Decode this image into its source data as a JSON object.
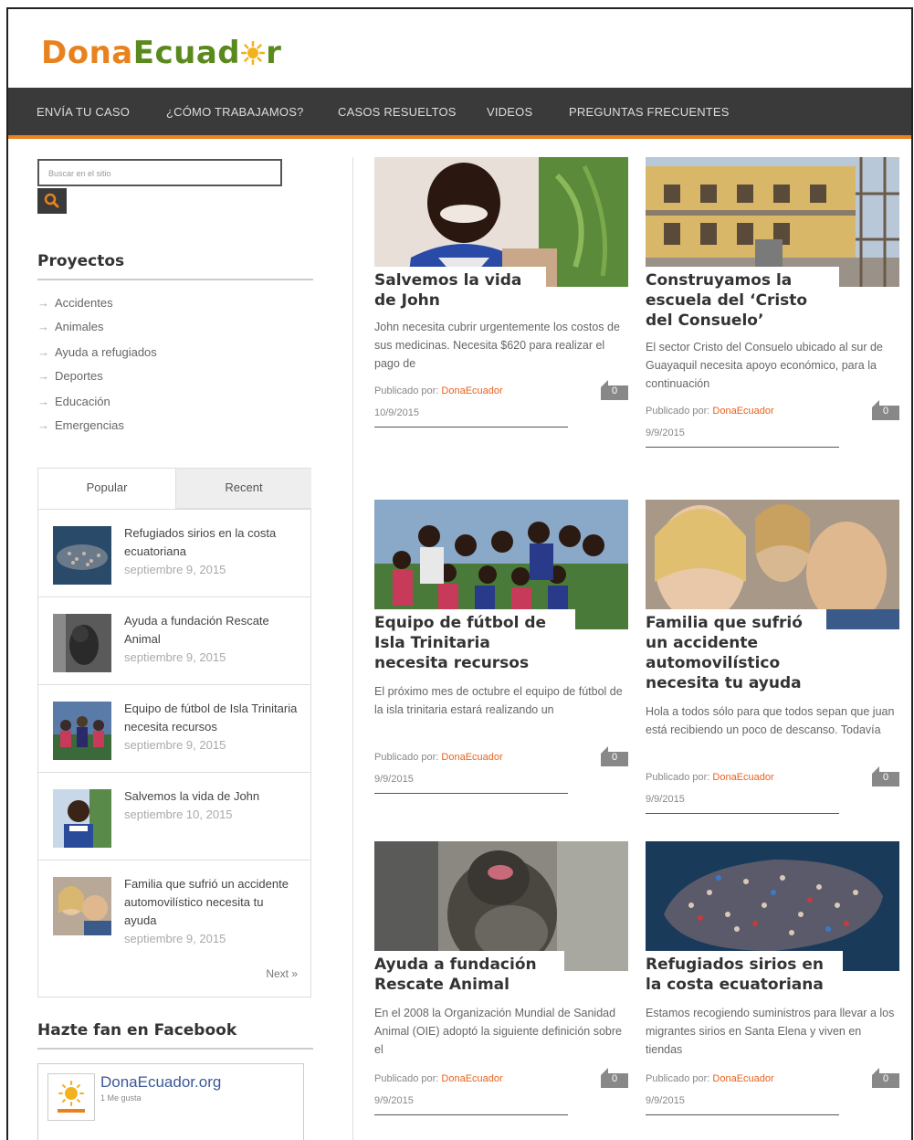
{
  "brand": {
    "part1": "Dona",
    "part2": "Ecuad",
    "part3": "r",
    "colors": {
      "orange": "#e8821e",
      "green": "#5a8a1e"
    }
  },
  "nav": [
    "ENVÍA TU CASO",
    "¿CÓMO TRABAJAMOS?",
    "CASOS RESUELTOS",
    "VIDEOS",
    "PREGUNTAS FRECUENTES"
  ],
  "search": {
    "placeholder": "Buscar en el sitio"
  },
  "projects": {
    "heading": "Proyectos",
    "items": [
      "Accidentes",
      "Animales",
      "Ayuda a refugiados",
      "Deportes",
      "Educación",
      "Emergencias"
    ]
  },
  "tabs": {
    "popular": "Popular",
    "recent": "Recent",
    "next": "Next »"
  },
  "popular": [
    {
      "title": "Refugiados sirios en la costa ecuatoriana",
      "date": "septiembre 9, 2015"
    },
    {
      "title": "Ayuda a fundación Rescate Animal",
      "date": "septiembre 9, 2015"
    },
    {
      "title": "Equipo de fútbol de Isla Trinitaria necesita recursos",
      "date": "septiembre 9, 2015"
    },
    {
      "title": "Salvemos la vida de John",
      "date": "septiembre 10, 2015"
    },
    {
      "title": "Familia que sufrió un accidente automovilístico necesita tu ayuda",
      "date": "septiembre 9, 2015"
    }
  ],
  "facebook": {
    "heading": "Hazte fan en Facebook",
    "page": "DonaEcuador.org",
    "likes": "1 Me gusta"
  },
  "posts": [
    {
      "title": "Salvemos la vida de John",
      "excerpt": "John necesita cubrir urgentemente los costos de sus medicinas. Necesita $620 para realizar el pago de",
      "by": "Publicado por:",
      "author": "DonaEcuador",
      "date": "10/9/2015",
      "comments": "0"
    },
    {
      "title": "Construyamos la escuela del ‘Cristo del Consuelo’",
      "excerpt": "El sector Cristo del Consuelo ubicado al sur de Guayaquil necesita apoyo económico, para la continuación",
      "by": "Publicado por:",
      "author": "DonaEcuador",
      "date": "9/9/2015",
      "comments": "0"
    },
    {
      "title": "Equipo de fútbol de Isla Trinitaria necesita recursos",
      "excerpt": "El próximo mes de octubre el equipo de fútbol de la isla trinitaria estará realizando un",
      "by": "Publicado por:",
      "author": "DonaEcuador",
      "date": "9/9/2015",
      "comments": "0"
    },
    {
      "title": "Familia que sufrió un accidente automovilístico necesita tu ayuda",
      "excerpt": "Hola a todos sólo para que todos sepan que juan está recibiendo un poco de descanso. Todavía",
      "by": "Publicado por:",
      "author": "DonaEcuador",
      "date": "9/9/2015",
      "comments": "0"
    },
    {
      "title": "Ayuda a fundación Rescate Animal",
      "excerpt": "En el 2008 la Organización Mundial de Sanidad Animal (OIE) adoptó la siguiente definición sobre el",
      "by": "Publicado por:",
      "author": "DonaEcuador",
      "date": "9/9/2015",
      "comments": "0"
    },
    {
      "title": "Refugiados sirios en la costa ecuatoriana",
      "excerpt": " Estamos recogiendo suministros para llevar a los migrantes sirios en Santa Elena y viven en tiendas",
      "by": "Publicado por:",
      "author": "DonaEcuador",
      "date": "9/9/2015",
      "comments": "0"
    }
  ]
}
